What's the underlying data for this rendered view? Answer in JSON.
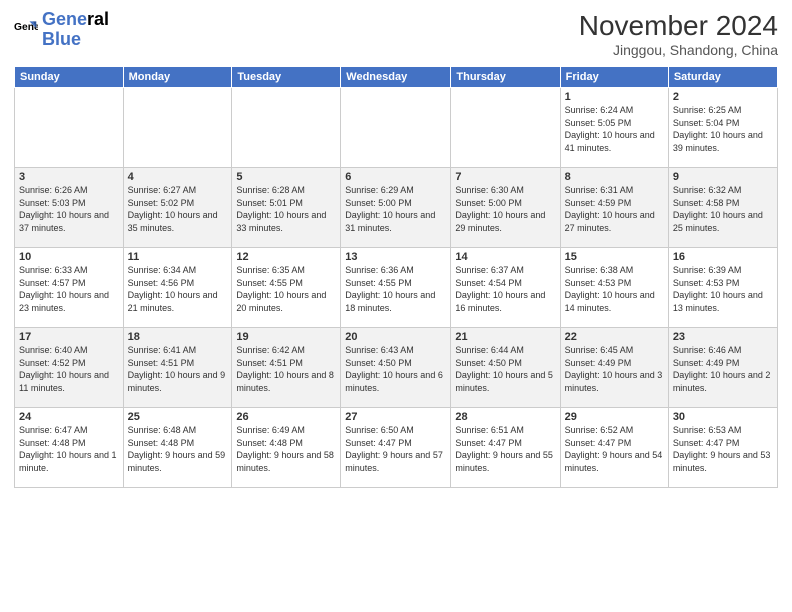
{
  "logo": {
    "line1": "General",
    "line2": "Blue"
  },
  "title": "November 2024",
  "location": "Jinggou, Shandong, China",
  "days_of_week": [
    "Sunday",
    "Monday",
    "Tuesday",
    "Wednesday",
    "Thursday",
    "Friday",
    "Saturday"
  ],
  "weeks": [
    [
      {
        "day": "",
        "info": ""
      },
      {
        "day": "",
        "info": ""
      },
      {
        "day": "",
        "info": ""
      },
      {
        "day": "",
        "info": ""
      },
      {
        "day": "",
        "info": ""
      },
      {
        "day": "1",
        "info": "Sunrise: 6:24 AM\nSunset: 5:05 PM\nDaylight: 10 hours and 41 minutes."
      },
      {
        "day": "2",
        "info": "Sunrise: 6:25 AM\nSunset: 5:04 PM\nDaylight: 10 hours and 39 minutes."
      }
    ],
    [
      {
        "day": "3",
        "info": "Sunrise: 6:26 AM\nSunset: 5:03 PM\nDaylight: 10 hours and 37 minutes."
      },
      {
        "day": "4",
        "info": "Sunrise: 6:27 AM\nSunset: 5:02 PM\nDaylight: 10 hours and 35 minutes."
      },
      {
        "day": "5",
        "info": "Sunrise: 6:28 AM\nSunset: 5:01 PM\nDaylight: 10 hours and 33 minutes."
      },
      {
        "day": "6",
        "info": "Sunrise: 6:29 AM\nSunset: 5:00 PM\nDaylight: 10 hours and 31 minutes."
      },
      {
        "day": "7",
        "info": "Sunrise: 6:30 AM\nSunset: 5:00 PM\nDaylight: 10 hours and 29 minutes."
      },
      {
        "day": "8",
        "info": "Sunrise: 6:31 AM\nSunset: 4:59 PM\nDaylight: 10 hours and 27 minutes."
      },
      {
        "day": "9",
        "info": "Sunrise: 6:32 AM\nSunset: 4:58 PM\nDaylight: 10 hours and 25 minutes."
      }
    ],
    [
      {
        "day": "10",
        "info": "Sunrise: 6:33 AM\nSunset: 4:57 PM\nDaylight: 10 hours and 23 minutes."
      },
      {
        "day": "11",
        "info": "Sunrise: 6:34 AM\nSunset: 4:56 PM\nDaylight: 10 hours and 21 minutes."
      },
      {
        "day": "12",
        "info": "Sunrise: 6:35 AM\nSunset: 4:55 PM\nDaylight: 10 hours and 20 minutes."
      },
      {
        "day": "13",
        "info": "Sunrise: 6:36 AM\nSunset: 4:55 PM\nDaylight: 10 hours and 18 minutes."
      },
      {
        "day": "14",
        "info": "Sunrise: 6:37 AM\nSunset: 4:54 PM\nDaylight: 10 hours and 16 minutes."
      },
      {
        "day": "15",
        "info": "Sunrise: 6:38 AM\nSunset: 4:53 PM\nDaylight: 10 hours and 14 minutes."
      },
      {
        "day": "16",
        "info": "Sunrise: 6:39 AM\nSunset: 4:53 PM\nDaylight: 10 hours and 13 minutes."
      }
    ],
    [
      {
        "day": "17",
        "info": "Sunrise: 6:40 AM\nSunset: 4:52 PM\nDaylight: 10 hours and 11 minutes."
      },
      {
        "day": "18",
        "info": "Sunrise: 6:41 AM\nSunset: 4:51 PM\nDaylight: 10 hours and 9 minutes."
      },
      {
        "day": "19",
        "info": "Sunrise: 6:42 AM\nSunset: 4:51 PM\nDaylight: 10 hours and 8 minutes."
      },
      {
        "day": "20",
        "info": "Sunrise: 6:43 AM\nSunset: 4:50 PM\nDaylight: 10 hours and 6 minutes."
      },
      {
        "day": "21",
        "info": "Sunrise: 6:44 AM\nSunset: 4:50 PM\nDaylight: 10 hours and 5 minutes."
      },
      {
        "day": "22",
        "info": "Sunrise: 6:45 AM\nSunset: 4:49 PM\nDaylight: 10 hours and 3 minutes."
      },
      {
        "day": "23",
        "info": "Sunrise: 6:46 AM\nSunset: 4:49 PM\nDaylight: 10 hours and 2 minutes."
      }
    ],
    [
      {
        "day": "24",
        "info": "Sunrise: 6:47 AM\nSunset: 4:48 PM\nDaylight: 10 hours and 1 minute."
      },
      {
        "day": "25",
        "info": "Sunrise: 6:48 AM\nSunset: 4:48 PM\nDaylight: 9 hours and 59 minutes."
      },
      {
        "day": "26",
        "info": "Sunrise: 6:49 AM\nSunset: 4:48 PM\nDaylight: 9 hours and 58 minutes."
      },
      {
        "day": "27",
        "info": "Sunrise: 6:50 AM\nSunset: 4:47 PM\nDaylight: 9 hours and 57 minutes."
      },
      {
        "day": "28",
        "info": "Sunrise: 6:51 AM\nSunset: 4:47 PM\nDaylight: 9 hours and 55 minutes."
      },
      {
        "day": "29",
        "info": "Sunrise: 6:52 AM\nSunset: 4:47 PM\nDaylight: 9 hours and 54 minutes."
      },
      {
        "day": "30",
        "info": "Sunrise: 6:53 AM\nSunset: 4:47 PM\nDaylight: 9 hours and 53 minutes."
      }
    ]
  ]
}
